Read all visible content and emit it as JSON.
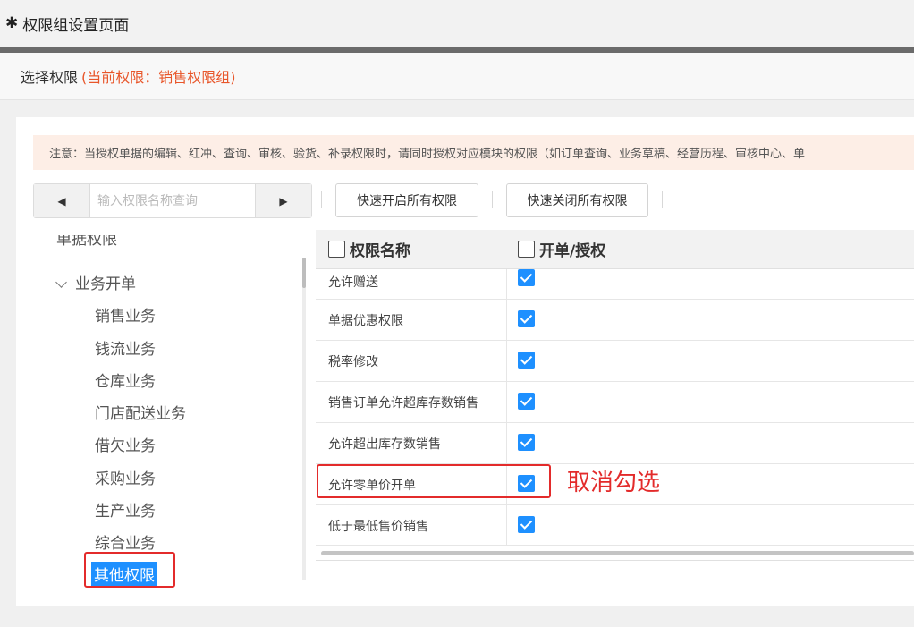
{
  "window": {
    "title": "权限组设置页面",
    "title_icon": "asterisk-icon"
  },
  "section": {
    "label": "选择权限",
    "current_text": "(当前权限：销售权限组)",
    "accent_color": "#e8562a"
  },
  "notice": {
    "text": "注意：当授权单据的编辑、红冲、查询、审核、验货、补录权限时，请同时授权对应模块的权限（如订单查询、业务草稿、经营历程、审核中心、单"
  },
  "toolbar": {
    "prev_icon": "triangle-left-icon",
    "next_icon": "triangle-right-icon",
    "search_placeholder": "输入权限名称查询",
    "enable_all_label": "快速开启所有权限",
    "disable_all_label": "快速关闭所有权限"
  },
  "tree": {
    "partial_top_label": "单据权限",
    "group_label": "业务开单",
    "items": [
      "销售业务",
      "钱流业务",
      "仓库业务",
      "门店配送业务",
      "借欠业务",
      "采购业务",
      "生产业务",
      "综合业务",
      "其他权限"
    ],
    "selected_item": "其他权限",
    "selected_color": "#1e90ff"
  },
  "grid": {
    "header_name": "权限名称",
    "header_grant": "开单/授权",
    "rows": [
      {
        "name": "允许赠送",
        "checked": true
      },
      {
        "name": "单据优惠权限",
        "checked": true
      },
      {
        "name": "税率修改",
        "checked": true
      },
      {
        "name": "销售订单允许超库存数销售",
        "checked": true
      },
      {
        "name": "允许超出库存数销售",
        "checked": true
      },
      {
        "name": "允许零单价开单",
        "checked": true
      },
      {
        "name": "低于最低售价销售",
        "checked": true
      }
    ],
    "checkbox_color": "#1e90ff"
  },
  "annotation": {
    "text": "取消勾选",
    "color": "#e32b2b"
  }
}
